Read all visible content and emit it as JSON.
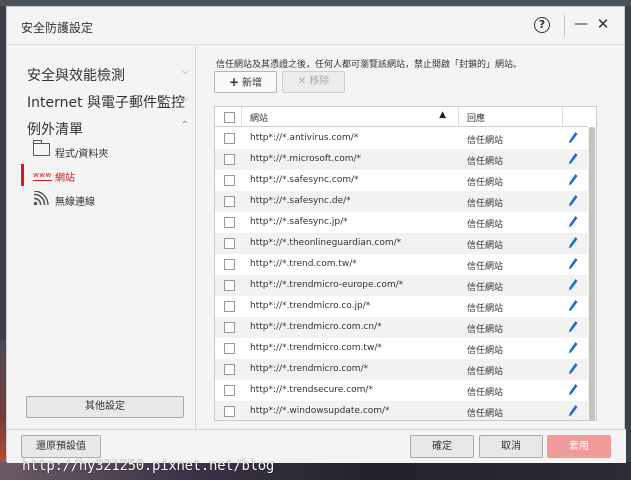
{
  "window": {
    "title": "安全防護設定",
    "help_symbol": "?",
    "minimize_symbol": "—",
    "close_symbol": "✕"
  },
  "sidebar": {
    "sections": [
      {
        "label": "安全與效能檢測",
        "chevron": "⌵"
      },
      {
        "label": "Internet 與電子郵件監控",
        "chevron": "⌵"
      },
      {
        "label": "例外清單",
        "chevron": "⌃"
      }
    ],
    "sub_items": [
      {
        "label": "程式/資料夾",
        "icon": "folder-icon"
      },
      {
        "label": "網站",
        "icon": "www-icon",
        "icon_text": "www",
        "active": true
      },
      {
        "label": "無線連線",
        "icon": "wifi-icon"
      }
    ],
    "other_settings_label": "其他設定"
  },
  "main": {
    "description": "信任網站及其憑證之後，任何人都可瀏覽該網站，禁止開啟「封鎖的」網站。",
    "add_label": "新增",
    "add_symbol": "+",
    "remove_label": "移除",
    "remove_symbol": "✕",
    "table": {
      "headers": {
        "site": "網站",
        "response": "回應",
        "sort_symbol": "▲"
      },
      "rows": [
        {
          "site": "http*://*.antivirus.com/*",
          "response": "信任網站"
        },
        {
          "site": "http*://*.microsoft.com/*",
          "response": "信任網站"
        },
        {
          "site": "http*://*.safesync.com/*",
          "response": "信任網站"
        },
        {
          "site": "http*://*.safesync.de/*",
          "response": "信任網站"
        },
        {
          "site": "http*://*.safesync.jp/*",
          "response": "信任網站"
        },
        {
          "site": "http*://*.theonlineguardian.com/*",
          "response": "信任網站"
        },
        {
          "site": "http*://*.trend.com.tw/*",
          "response": "信任網站"
        },
        {
          "site": "http*://*.trendmicro-europe.com/*",
          "response": "信任網站"
        },
        {
          "site": "http*://*.trendmicro.co.jp/*",
          "response": "信任網站"
        },
        {
          "site": "http*://*.trendmicro.com.cn/*",
          "response": "信任網站"
        },
        {
          "site": "http*://*.trendmicro.com.tw/*",
          "response": "信任網站"
        },
        {
          "site": "http*://*.trendmicro.com/*",
          "response": "信任網站"
        },
        {
          "site": "http*://*.trendsecure.com/*",
          "response": "信任網站"
        },
        {
          "site": "http*://*.windowsupdate.com/*",
          "response": "信任網站"
        }
      ]
    }
  },
  "footer": {
    "restore_label": "還原預設值",
    "ok_label": "確定",
    "cancel_label": "取消",
    "apply_label": "套用"
  },
  "watermark": "http://hy321250.pixnet.net/blog",
  "colors": {
    "accent": "#d71920",
    "edit_icon": "#1e6fd0",
    "apply_disabled": "#f09a9a"
  }
}
